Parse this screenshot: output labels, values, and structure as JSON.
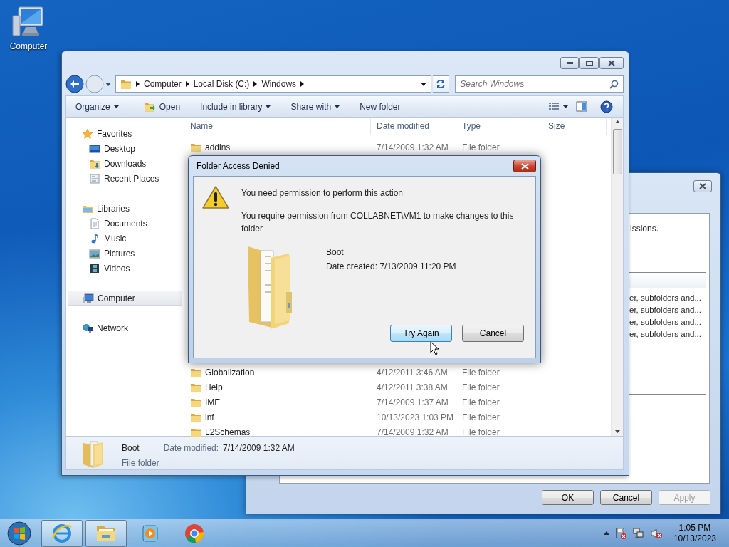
{
  "desktop_icons": [
    {
      "label": "Computer",
      "kind": "computer"
    }
  ],
  "properties_window": {
    "partial_text": "issions.",
    "permission_rows": [
      "er, subfolders and...",
      "er, subfolders and...",
      "er, subfolders and...",
      "er, subfolders and..."
    ],
    "buttons": [
      {
        "label": "OK",
        "disabled": false
      },
      {
        "label": "Cancel",
        "disabled": false
      },
      {
        "label": "Apply",
        "disabled": true
      }
    ]
  },
  "explorer": {
    "breadcrumb": [
      "Computer",
      "Local Disk (C:)",
      "Windows"
    ],
    "search": {
      "placeholder": "Search Windows"
    },
    "toolbar": [
      {
        "label": "Organize",
        "kind": "menu"
      },
      {
        "label": "Open",
        "kind": "open"
      },
      {
        "label": "Include in library",
        "kind": "menu"
      },
      {
        "label": "Share with",
        "kind": "menu"
      },
      {
        "label": "New folder",
        "kind": "plain"
      }
    ],
    "nav": [
      {
        "label": "Favorites",
        "kind": "star",
        "selected": false,
        "children": [
          {
            "label": "Desktop",
            "kind": "desktop",
            "selected": false
          },
          {
            "label": "Downloads",
            "kind": "downloads",
            "selected": false
          },
          {
            "label": "Recent Places",
            "kind": "recent",
            "selected": false
          }
        ]
      },
      {
        "label": "Libraries",
        "kind": "libraries",
        "selected": false,
        "children": [
          {
            "label": "Documents",
            "kind": "documents",
            "selected": false
          },
          {
            "label": "Music",
            "kind": "music",
            "selected": false
          },
          {
            "label": "Pictures",
            "kind": "pictures",
            "selected": false
          },
          {
            "label": "Videos",
            "kind": "videos",
            "selected": false
          }
        ]
      },
      {
        "label": "Computer",
        "kind": "computer",
        "selected": true
      },
      {
        "label": "Network",
        "kind": "network",
        "selected": false
      }
    ],
    "columns": [
      "Name",
      "Date modified",
      "Type",
      "Size"
    ],
    "rows_above": [
      {
        "name": "addins",
        "date": "7/14/2009 1:32 AM",
        "type": "File folder"
      }
    ],
    "rows_below": [
      {
        "name": "Globalization",
        "date": "4/12/2011 3:46 AM",
        "type": "File folder"
      },
      {
        "name": "Help",
        "date": "4/12/2011 3:38 AM",
        "type": "File folder"
      },
      {
        "name": "IME",
        "date": "7/14/2009 1:37 AM",
        "type": "File folder"
      },
      {
        "name": "inf",
        "date": "10/13/2023 1:03 PM",
        "type": "File folder"
      },
      {
        "name": "L2Schemas",
        "date": "7/14/2009 1:32 AM",
        "type": "File folder"
      }
    ],
    "details": {
      "name": "Boot",
      "type": "File folder",
      "date_label": "Date modified:",
      "date": "7/14/2009 1:32 AM"
    }
  },
  "dialog": {
    "title": "Folder Access Denied",
    "heading": "You need permission to perform this action",
    "message": "You require permission from COLLABNET\\VM1 to make changes to this folder",
    "item": {
      "name": "Boot",
      "created": "Date created: 7/13/2009 11:20 PM"
    },
    "buttons": [
      {
        "label": "Try Again",
        "focused": true
      },
      {
        "label": "Cancel",
        "focused": false
      }
    ]
  },
  "taskbar": {
    "apps": [
      {
        "kind": "browser",
        "running": true
      },
      {
        "kind": "explorer",
        "running": true
      },
      {
        "kind": "media",
        "running": false
      },
      {
        "kind": "chrome",
        "running": false
      }
    ],
    "time": "1:05 PM",
    "date": "10/13/2023"
  }
}
